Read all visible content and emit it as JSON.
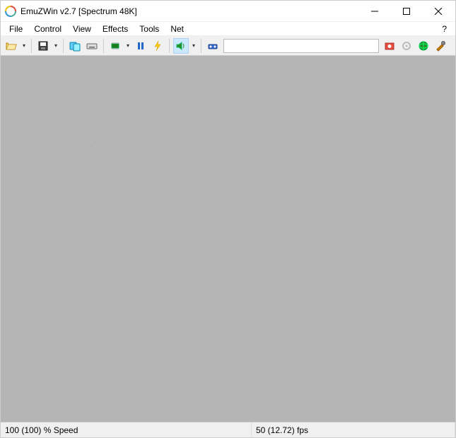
{
  "window": {
    "title": "EmuZWin v2.7 [Spectrum 48K]",
    "help_char": "?"
  },
  "menu": {
    "items": [
      "File",
      "Control",
      "View",
      "Effects",
      "Tools",
      "Net"
    ]
  },
  "toolbar": {
    "input_value": ""
  },
  "status": {
    "speed": "100 (100) % Speed",
    "fps": "50 (12.72) fps"
  },
  "colors": {
    "content_bg": "#b5b5b5"
  }
}
